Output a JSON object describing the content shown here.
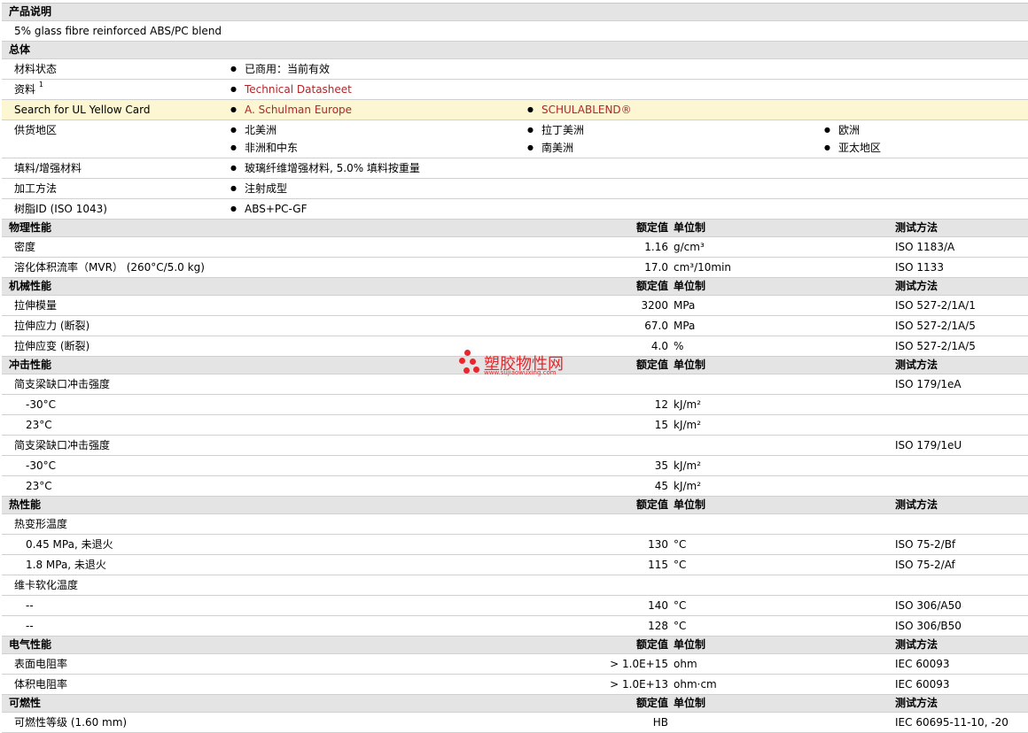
{
  "product_desc": {
    "header": "产品说明",
    "text": "5% glass fibre reinforced ABS/PC blend"
  },
  "general": {
    "header": "总体",
    "material_status": {
      "label": "材料状态",
      "value": "已商用：当前有效"
    },
    "data": {
      "label": "资料",
      "sup": "1",
      "link": "Technical Datasheet"
    },
    "ul": {
      "label": "Search for UL Yellow Card",
      "link1": "A. Schulman Europe",
      "link2": "SCHULABLEND®"
    },
    "supply": {
      "label": "供货地区",
      "regions": [
        "北美洲",
        "拉丁美洲",
        "欧洲",
        "非洲和中东",
        "南美洲",
        "亚太地区"
      ]
    },
    "filler": {
      "label": "填料/增强材料",
      "value": "玻璃纤维增强材料, 5.0% 填料按重量"
    },
    "processing": {
      "label": "加工方法",
      "value": "注射成型"
    },
    "resin": {
      "label": "树脂ID (ISO 1043)",
      "value": "ABS+PC-GF"
    }
  },
  "cols": {
    "nominal": "额定值",
    "unit": "单位制",
    "method": "测试方法"
  },
  "physical": {
    "header": "物理性能",
    "rows": [
      {
        "label": "密度",
        "value": "1.16",
        "unit": "g/cm³",
        "method": "ISO 1183/A"
      },
      {
        "label": "溶化体积流率（MVR） (260°C/5.0 kg)",
        "value": "17.0",
        "unit": "cm³/10min",
        "method": "ISO 1133"
      }
    ]
  },
  "mechanical": {
    "header": "机械性能",
    "rows": [
      {
        "label": "拉伸模量",
        "value": "3200",
        "unit": "MPa",
        "method": "ISO 527-2/1A/1"
      },
      {
        "label": "拉伸应力 (断裂)",
        "value": "67.0",
        "unit": "MPa",
        "method": "ISO 527-2/1A/5"
      },
      {
        "label": "拉伸应变 (断裂)",
        "value": "4.0",
        "unit": "%",
        "method": "ISO 527-2/1A/5"
      }
    ]
  },
  "impact": {
    "header": "冲击性能",
    "g1": {
      "label": "简支梁缺口冲击强度",
      "method": "ISO 179/1eA",
      "rows": [
        {
          "label": "-30°C",
          "value": "12",
          "unit": "kJ/m²"
        },
        {
          "label": "23°C",
          "value": "15",
          "unit": "kJ/m²"
        }
      ]
    },
    "g2": {
      "label": "简支梁缺口冲击强度",
      "method": "ISO 179/1eU",
      "rows": [
        {
          "label": "-30°C",
          "value": "35",
          "unit": "kJ/m²"
        },
        {
          "label": "23°C",
          "value": "45",
          "unit": "kJ/m²"
        }
      ]
    }
  },
  "thermal": {
    "header": "热性能",
    "g1": {
      "label": "热变形温度",
      "rows": [
        {
          "label": "0.45 MPa, 未退火",
          "value": "130",
          "unit": "°C",
          "method": "ISO 75-2/Bf"
        },
        {
          "label": "1.8 MPa, 未退火",
          "value": "115",
          "unit": "°C",
          "method": "ISO 75-2/Af"
        }
      ]
    },
    "g2": {
      "label": "维卡软化温度",
      "rows": [
        {
          "label": "--",
          "value": "140",
          "unit": "°C",
          "method": "ISO 306/A50"
        },
        {
          "label": "--",
          "value": "128",
          "unit": "°C",
          "method": "ISO 306/B50"
        }
      ]
    }
  },
  "electrical": {
    "header": "电气性能",
    "rows": [
      {
        "label": "表面电阻率",
        "value": "> 1.0E+15",
        "unit": "ohm",
        "method": "IEC 60093"
      },
      {
        "label": "体积电阻率",
        "value": "> 1.0E+13",
        "unit": "ohm·cm",
        "method": "IEC 60093"
      }
    ]
  },
  "flammability": {
    "header": "可燃性",
    "rows": [
      {
        "label": "可燃性等级 (1.60 mm)",
        "value": "HB",
        "unit": "",
        "method": "IEC 60695-11-10, -20"
      }
    ]
  },
  "watermark": {
    "title": "塑胶物性网",
    "url": "www.sujiaowuxing.com",
    "color": "#e8262b"
  }
}
